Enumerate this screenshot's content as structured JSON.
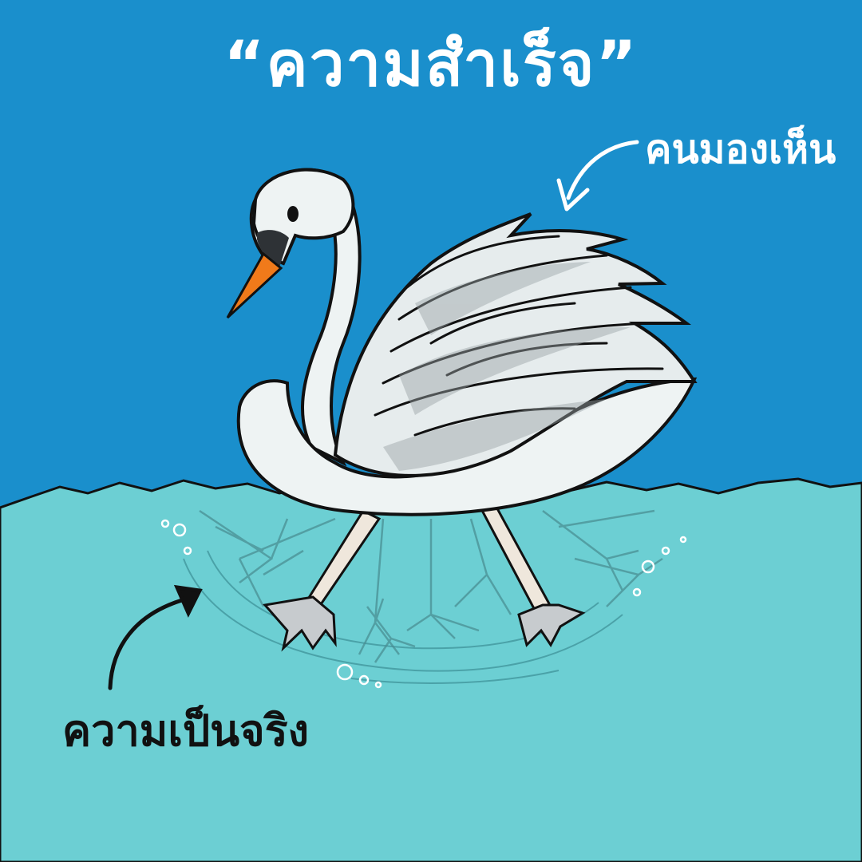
{
  "title": "“ความสำเร็จ”",
  "label_seen": "คนมองเห็น",
  "label_reality": "ความเป็นจริง",
  "colors": {
    "sky": "#1a8fcc",
    "water": "#6ccfd3",
    "swan": "#eef3f3",
    "beak": "#f07a1a",
    "outline": "#111111",
    "text_light": "#ffffff",
    "text_dark": "#111111"
  },
  "icons": [
    "arrow-icon",
    "swan-icon",
    "bubble-icon",
    "webbed-foot-icon"
  ]
}
